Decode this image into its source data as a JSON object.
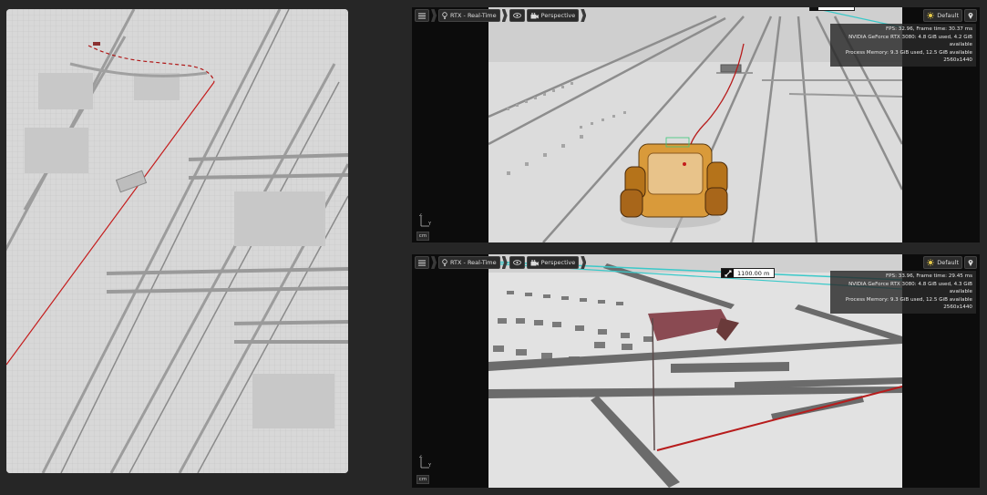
{
  "viewports": [
    {
      "id": "top",
      "renderer_label": "RTX - Real-Time",
      "camera_label": "Perspective",
      "lighting_label": "Default",
      "stats": {
        "fps_line": "FPS: 32.96, Frame time: 30.37 ms",
        "gpu_line": "NVIDIA GeForce RTX 3080: 4.8 GiB used, 4.2 GiB available",
        "memory_line": "Process Memory: 9.3 GiB used, 12.5 GiB available",
        "resolution": "2560x1440"
      },
      "units": "cm",
      "measurement": ""
    },
    {
      "id": "bottom",
      "renderer_label": "RTX - Real-Time",
      "camera_label": "Perspective",
      "lighting_label": "Default",
      "stats": {
        "fps_line": "FPS: 33.96, Frame time: 29.45 ms",
        "gpu_line": "NVIDIA GeForce RTX 3080: 4.8 GiB used, 4.3 GiB available",
        "memory_line": "Process Memory: 9.3 GiB used, 12.5 GiB available",
        "resolution": "2560x1440"
      },
      "units": "cm",
      "measurement": "1100.00 m"
    }
  ],
  "colors": {
    "background": "#262626",
    "path_red": "#c41c1c",
    "measure_cyan": "#3ac9c9",
    "robot_orange": "#d98a1e"
  },
  "icons": [
    "menu-icon",
    "lightbulb-icon",
    "eye-icon",
    "camera-icon",
    "sun-icon",
    "location-pin-icon",
    "ruler-icon"
  ]
}
